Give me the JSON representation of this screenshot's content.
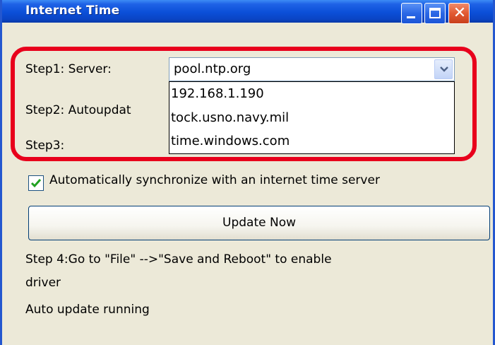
{
  "window": {
    "title": "Internet Time"
  },
  "steps": {
    "step1_label": "Step1: Server:",
    "step2_label": "Step2: Autoupdat",
    "step3_label": "Step3:"
  },
  "server_combo": {
    "selected": "pool.ntp.org",
    "options": [
      "192.168.1.190",
      "tock.usno.navy.mil",
      "time.windows.com"
    ]
  },
  "auto_sync": {
    "checked": true,
    "label": "Automatically synchronize with an internet time server"
  },
  "update_button": {
    "label": "Update Now"
  },
  "step4": {
    "line1": "Step 4:Go to \"File\" -->\"Save and Reboot\" to enable",
    "line2": "driver"
  },
  "status": {
    "text": "Auto update running"
  },
  "colors": {
    "titlebar": "#0b4fd8",
    "window_bg": "#ece9d8",
    "highlight_ring": "#e8001c",
    "checkmark": "#21a121"
  }
}
